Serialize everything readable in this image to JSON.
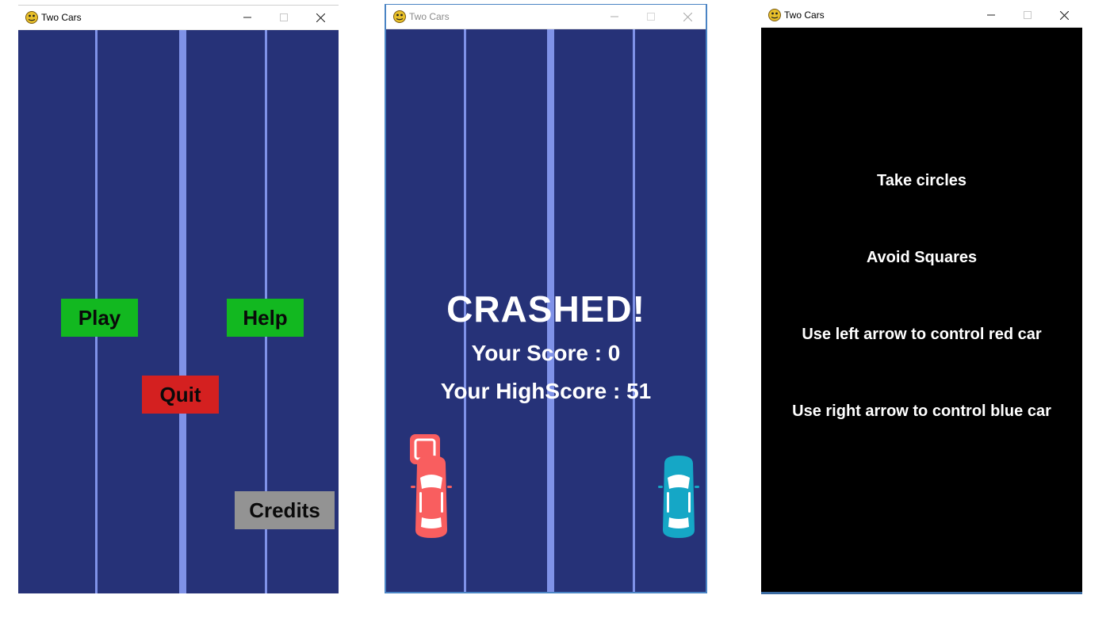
{
  "windows": [
    {
      "title": "Two Cars",
      "menu": {
        "play_label": "Play",
        "help_label": "Help",
        "quit_label": "Quit",
        "credits_label": "Credits"
      }
    },
    {
      "title": "Two Cars",
      "crash": {
        "heading": "CRASHED!",
        "score_text": "Your Score : 0",
        "highscore_text": "Your HighScore : 51"
      }
    },
    {
      "title": "Two Cars",
      "help": {
        "lines": [
          "Take circles",
          "Avoid Squares",
          "Use left arrow to control red car",
          "Use right arrow to control blue car"
        ]
      }
    }
  ],
  "colors": {
    "road": "#263278",
    "lane": "#7f92e8",
    "play": "#12b820",
    "help": "#12b820",
    "quit": "#d42020",
    "credits": "#939393",
    "red_car": "#f95e5f",
    "blue_car": "#15a7c6",
    "help_bg": "#000000"
  },
  "icons": {
    "app": "pygame-snake-icon",
    "minimize": "minimize-icon",
    "maximize": "maximize-icon",
    "close": "close-icon"
  }
}
